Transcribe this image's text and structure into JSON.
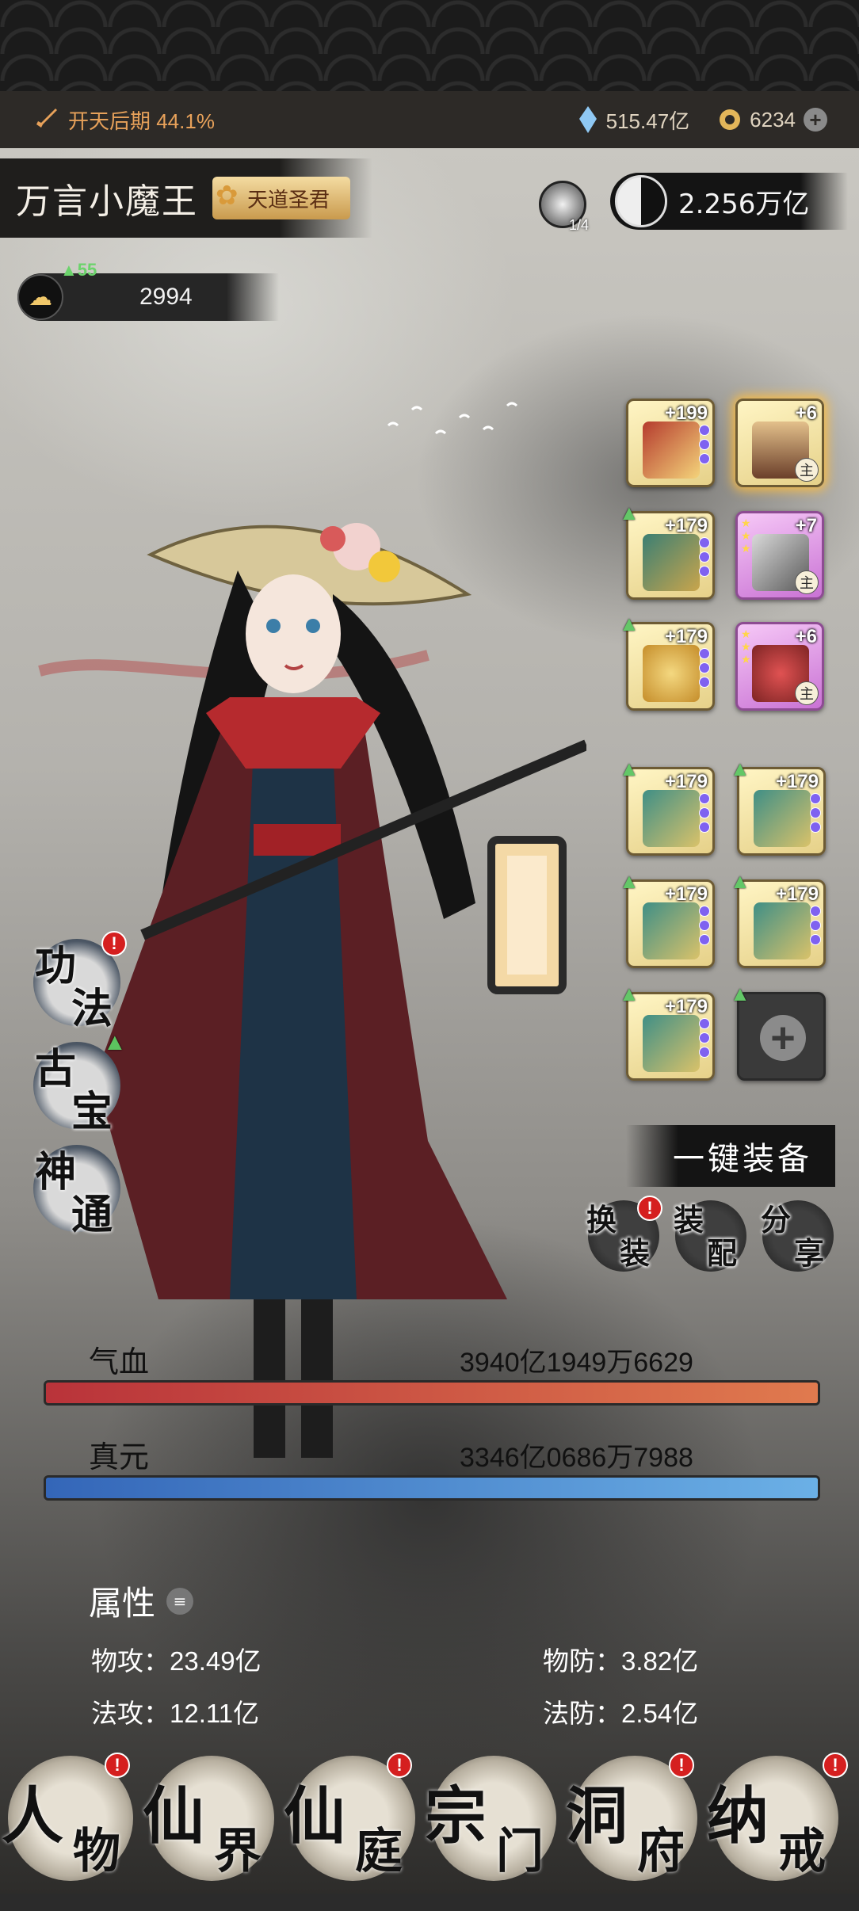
{
  "resources": {
    "realm": "开天后期 44.1%",
    "crystal": "515.47亿",
    "coins": "6234"
  },
  "player": {
    "name": "万言小魔王",
    "title_badge": "天道圣君",
    "stage": "1/4",
    "power": "2.256万亿",
    "level_up_count": "55",
    "level_value": "2994"
  },
  "equipment": [
    {
      "level": "+199",
      "main": ""
    },
    {
      "level": "+6",
      "main": "主"
    },
    {
      "level": "+179",
      "main": ""
    },
    {
      "level": "+7",
      "main": "主"
    },
    {
      "level": "+179",
      "main": ""
    },
    {
      "level": "+6",
      "main": "主"
    },
    {
      "level": "+179",
      "main": ""
    },
    {
      "level": "+179",
      "main": ""
    },
    {
      "level": "+179",
      "main": ""
    },
    {
      "level": "+179",
      "main": ""
    },
    {
      "level": "+179",
      "main": ""
    }
  ],
  "left_menu": {
    "gongfa": [
      "功",
      "法"
    ],
    "gubao": [
      "古",
      "宝"
    ],
    "shentong": [
      "神",
      "通"
    ]
  },
  "actions": {
    "one_key": "一键装备",
    "swap": [
      "换",
      "装"
    ],
    "config": [
      "装",
      "配"
    ],
    "share": [
      "分",
      "享"
    ]
  },
  "stats": {
    "hp_label": "气血",
    "hp_value": "3940亿1949万6629",
    "mp_label": "真元",
    "mp_value": "3346亿0686万7988"
  },
  "attributes": {
    "title": "属性",
    "phys_atk": "物攻：23.49亿",
    "phys_def": "物防：3.82亿",
    "mag_atk": "法攻：12.11亿",
    "mag_def": "法防：2.54亿"
  },
  "nav": [
    {
      "a": "人",
      "b": "物"
    },
    {
      "a": "仙",
      "b": "界"
    },
    {
      "a": "仙",
      "b": "庭"
    },
    {
      "a": "宗",
      "b": "门"
    },
    {
      "a": "洞",
      "b": "府"
    },
    {
      "a": "纳",
      "b": "戒"
    }
  ],
  "colors": {
    "hp_fill": "#c2413c",
    "mp_fill": "#3f7fcf",
    "badge": "#d51f1f"
  }
}
